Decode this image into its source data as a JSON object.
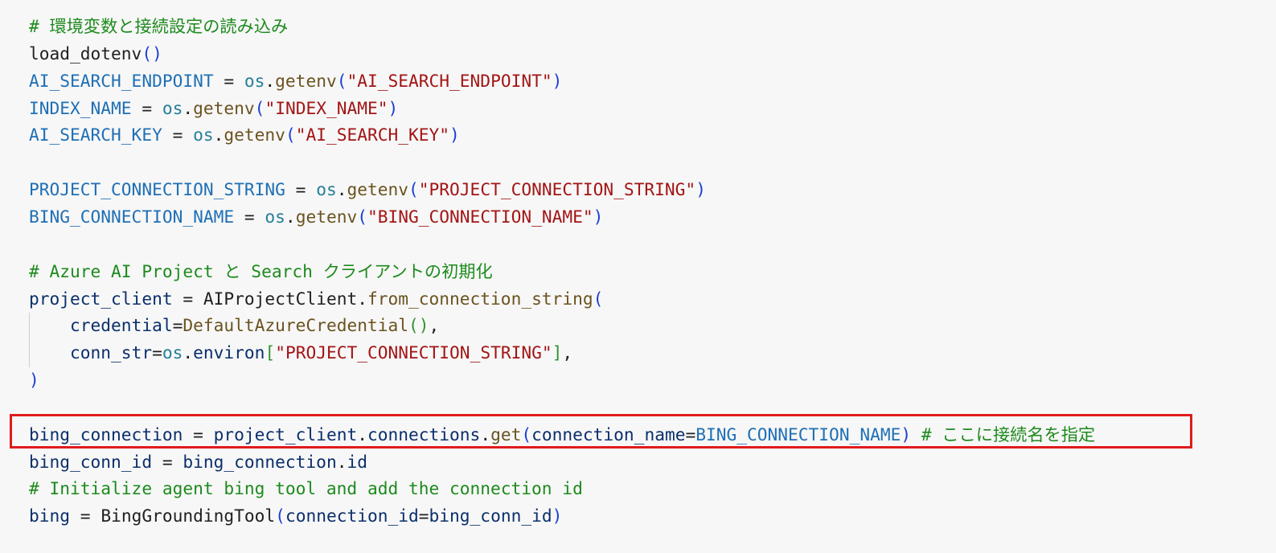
{
  "highlight_color": "#e01b1b",
  "background_color": "#f7f7f7",
  "lines": [
    {
      "tokens": [
        {
          "text": "# 環境変数と接続設定の読み込み",
          "kind": "com"
        }
      ]
    },
    {
      "tokens": [
        {
          "text": "load_dotenv",
          "kind": "default"
        },
        {
          "text": "()",
          "kind": "p1"
        }
      ]
    },
    {
      "tokens": [
        {
          "text": "AI_SEARCH_ENDPOINT",
          "kind": "var"
        },
        {
          "text": " = ",
          "kind": "default"
        },
        {
          "text": "os",
          "kind": "mod"
        },
        {
          "text": ".",
          "kind": "default"
        },
        {
          "text": "getenv",
          "kind": "fn"
        },
        {
          "text": "(",
          "kind": "p1"
        },
        {
          "text": "\"AI_SEARCH_ENDPOINT\"",
          "kind": "str"
        },
        {
          "text": ")",
          "kind": "p1"
        }
      ]
    },
    {
      "tokens": [
        {
          "text": "INDEX_NAME",
          "kind": "var"
        },
        {
          "text": " = ",
          "kind": "default"
        },
        {
          "text": "os",
          "kind": "mod"
        },
        {
          "text": ".",
          "kind": "default"
        },
        {
          "text": "getenv",
          "kind": "fn"
        },
        {
          "text": "(",
          "kind": "p1"
        },
        {
          "text": "\"INDEX_NAME\"",
          "kind": "str"
        },
        {
          "text": ")",
          "kind": "p1"
        }
      ]
    },
    {
      "tokens": [
        {
          "text": "AI_SEARCH_KEY",
          "kind": "var"
        },
        {
          "text": " = ",
          "kind": "default"
        },
        {
          "text": "os",
          "kind": "mod"
        },
        {
          "text": ".",
          "kind": "default"
        },
        {
          "text": "getenv",
          "kind": "fn"
        },
        {
          "text": "(",
          "kind": "p1"
        },
        {
          "text": "\"AI_SEARCH_KEY\"",
          "kind": "str"
        },
        {
          "text": ")",
          "kind": "p1"
        }
      ]
    },
    {
      "tokens": []
    },
    {
      "tokens": [
        {
          "text": "PROJECT_CONNECTION_STRING",
          "kind": "var"
        },
        {
          "text": " = ",
          "kind": "default"
        },
        {
          "text": "os",
          "kind": "mod"
        },
        {
          "text": ".",
          "kind": "default"
        },
        {
          "text": "getenv",
          "kind": "fn"
        },
        {
          "text": "(",
          "kind": "p1"
        },
        {
          "text": "\"PROJECT_CONNECTION_STRING\"",
          "kind": "str"
        },
        {
          "text": ")",
          "kind": "p1"
        }
      ]
    },
    {
      "tokens": [
        {
          "text": "BING_CONNECTION_NAME",
          "kind": "var"
        },
        {
          "text": " = ",
          "kind": "default"
        },
        {
          "text": "os",
          "kind": "mod"
        },
        {
          "text": ".",
          "kind": "default"
        },
        {
          "text": "getenv",
          "kind": "fn"
        },
        {
          "text": "(",
          "kind": "p1"
        },
        {
          "text": "\"BING_CONNECTION_NAME\"",
          "kind": "str"
        },
        {
          "text": ")",
          "kind": "p1"
        }
      ]
    },
    {
      "tokens": []
    },
    {
      "tokens": [
        {
          "text": "# Azure AI Project と Search クライアントの初期化",
          "kind": "com"
        }
      ]
    },
    {
      "tokens": [
        {
          "text": "project_client",
          "kind": "param"
        },
        {
          "text": " = ",
          "kind": "default"
        },
        {
          "text": "AIProjectClient",
          "kind": "default"
        },
        {
          "text": ".",
          "kind": "default"
        },
        {
          "text": "from_connection_string",
          "kind": "fn"
        },
        {
          "text": "(",
          "kind": "p1"
        }
      ]
    },
    {
      "tokens": [
        {
          "text": "    ",
          "kind": "default"
        },
        {
          "text": "credential",
          "kind": "param"
        },
        {
          "text": "=",
          "kind": "default"
        },
        {
          "text": "DefaultAzureCredential",
          "kind": "fn"
        },
        {
          "text": "()",
          "kind": "p2"
        },
        {
          "text": ",",
          "kind": "default"
        }
      ]
    },
    {
      "tokens": [
        {
          "text": "    ",
          "kind": "default"
        },
        {
          "text": "conn_str",
          "kind": "param"
        },
        {
          "text": "=",
          "kind": "default"
        },
        {
          "text": "os",
          "kind": "mod"
        },
        {
          "text": ".",
          "kind": "default"
        },
        {
          "text": "environ",
          "kind": "param"
        },
        {
          "text": "[",
          "kind": "p2"
        },
        {
          "text": "\"PROJECT_CONNECTION_STRING\"",
          "kind": "str"
        },
        {
          "text": "]",
          "kind": "p2"
        },
        {
          "text": ",",
          "kind": "default"
        }
      ]
    },
    {
      "tokens": [
        {
          "text": ")",
          "kind": "p1"
        }
      ]
    },
    {
      "tokens": []
    },
    {
      "tokens": [
        {
          "text": "bing_connection",
          "kind": "param"
        },
        {
          "text": " = ",
          "kind": "default"
        },
        {
          "text": "project_client",
          "kind": "param"
        },
        {
          "text": ".",
          "kind": "default"
        },
        {
          "text": "connections",
          "kind": "param"
        },
        {
          "text": ".",
          "kind": "default"
        },
        {
          "text": "get",
          "kind": "fn"
        },
        {
          "text": "(",
          "kind": "p1"
        },
        {
          "text": "connection_name",
          "kind": "param"
        },
        {
          "text": "=",
          "kind": "default"
        },
        {
          "text": "BING_CONNECTION_NAME",
          "kind": "var"
        },
        {
          "text": ")",
          "kind": "p1"
        },
        {
          "text": " # ここに接続名を指定",
          "kind": "com"
        }
      ]
    },
    {
      "tokens": [
        {
          "text": "bing_conn_id",
          "kind": "param"
        },
        {
          "text": " = ",
          "kind": "default"
        },
        {
          "text": "bing_connection",
          "kind": "param"
        },
        {
          "text": ".",
          "kind": "default"
        },
        {
          "text": "id",
          "kind": "param"
        }
      ]
    },
    {
      "tokens": [
        {
          "text": "# Initialize agent bing tool and add the connection id",
          "kind": "com"
        }
      ]
    },
    {
      "tokens": [
        {
          "text": "bing",
          "kind": "param"
        },
        {
          "text": " = ",
          "kind": "default"
        },
        {
          "text": "BingGroundingTool",
          "kind": "default"
        },
        {
          "text": "(",
          "kind": "p1"
        },
        {
          "text": "connection_id",
          "kind": "param"
        },
        {
          "text": "=",
          "kind": "default"
        },
        {
          "text": "bing_conn_id",
          "kind": "param"
        },
        {
          "text": ")",
          "kind": "p1"
        }
      ]
    }
  ]
}
